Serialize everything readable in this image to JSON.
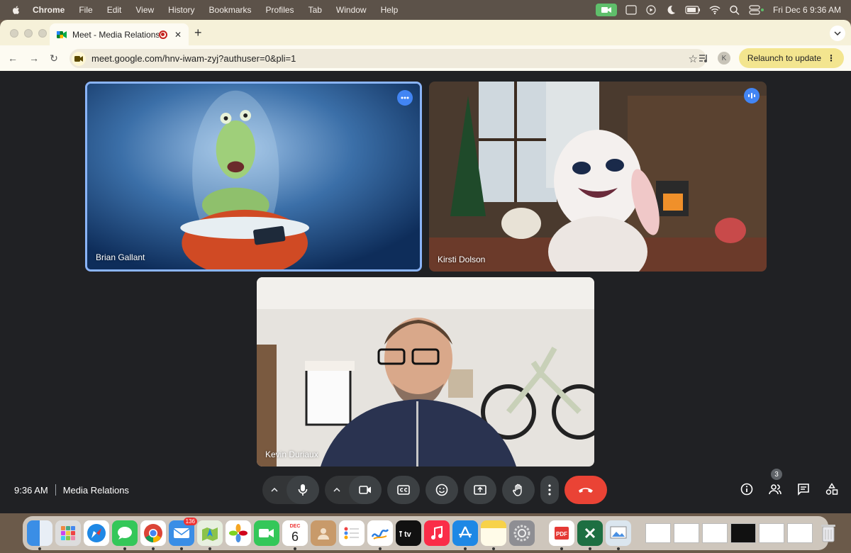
{
  "menubar": {
    "items": [
      "Chrome",
      "File",
      "Edit",
      "View",
      "History",
      "Bookmarks",
      "Profiles",
      "Tab",
      "Window",
      "Help"
    ],
    "datetime": "Fri Dec 6  9:36 AM"
  },
  "browser": {
    "tab_title": "Meet - Media Relations",
    "url": "meet.google.com/hnv-iwam-zyj?authuser=0&pli=1",
    "profile_initial": "K",
    "relaunch_label": "Relaunch to update"
  },
  "meeting": {
    "time": "9:36 AM",
    "title": "Media Relations",
    "participant_count": "3",
    "participants": [
      {
        "name": "Brian Gallant"
      },
      {
        "name": "Kirsti Dolson"
      },
      {
        "name": "Kevin Duriaux"
      }
    ]
  },
  "dock": {
    "calendar_month": "DEC",
    "calendar_day": "6",
    "mail_badge": "136"
  },
  "colors": {
    "meet_bg": "#202124",
    "active_speaker": "#8ab4f8",
    "end_call": "#ea4335",
    "relaunch": "#f3e58f"
  }
}
